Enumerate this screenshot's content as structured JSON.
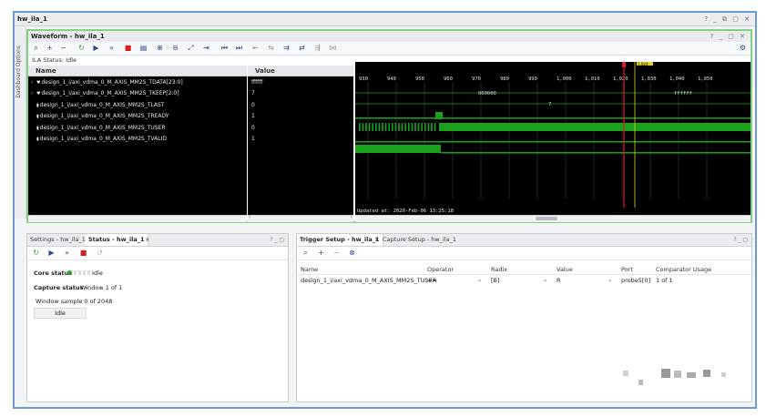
{
  "window": {
    "title": "hw_ila_1",
    "controls": "? _ ⧉ ▢ ✕"
  },
  "side_tab": {
    "label": "Dashboard Options"
  },
  "waveform": {
    "title": "Waveform - hw_ila_1",
    "controls": "? _ ▢ ✕",
    "ila_status": "ILA Status: Idle",
    "col_name": "Name",
    "col_value": "Value",
    "signals": [
      {
        "name": "design_1_i/axi_vdma_0_M_AXIS_MM2S_TDATA[23:0]",
        "value": "ffffff",
        "expand": "›"
      },
      {
        "name": "design_1_i/axi_vdma_0_M_AXIS_MM2S_TKEEP[2:0]",
        "value": "7",
        "expand": "›"
      },
      {
        "name": "design_1_i/axi_vdma_0_M_AXIS_MM2S_TLAST",
        "value": "0",
        "expand": ""
      },
      {
        "name": "design_1_i/axi_vdma_0_M_AXIS_MM2S_TREADY",
        "value": "1",
        "expand": ""
      },
      {
        "name": "design_1_i/axi_vdma_0_M_AXIS_MM2S_TUSER",
        "value": "0",
        "expand": ""
      },
      {
        "name": "design_1_i/axi_vdma_0_M_AXIS_MM2S_TVALID",
        "value": "1",
        "expand": ""
      }
    ],
    "ticks": [
      "930",
      "940",
      "950",
      "960",
      "970",
      "980",
      "990",
      "1,000",
      "1,010",
      "1,020",
      "1,030",
      "1,040",
      "1,050"
    ],
    "bus_values": {
      "tdata_left": "000000",
      "tdata_right": "ffffff",
      "tkeep": "7"
    },
    "updated": "Updated at: 2020-Feb-06 13:25:18",
    "marker_label": "1,024"
  },
  "settings_panel": {
    "tabs": [
      "Settings - hw_ila_1",
      "Status - hw_ila_1"
    ],
    "close": "×",
    "controls": "? _ ▢",
    "core_status_label": "Core status",
    "core_status_value": "Idle",
    "capture_status_label": "Capture status -",
    "capture_status_value": "Window 1 of 1",
    "window_sample": "Window sample 0 of 2048",
    "idle_box": "Idle"
  },
  "trigger_panel": {
    "tabs": [
      "Trigger Setup - hw_ila_1",
      "Capture Setup - hw_ila_1"
    ],
    "close": "×",
    "controls": "? _ ▢",
    "columns": [
      "Name",
      "Operator",
      "Radix",
      "Value",
      "Port",
      "Comparator Usage"
    ],
    "row": {
      "name": "design_1_i/axi_vdma_0_M_AXIS_MM2S_TUSER",
      "operator": "==",
      "radix": "[B]",
      "value": "R",
      "port": "probe5[0]",
      "usage": "1 of 1"
    }
  },
  "colors": {
    "accent": "#6d9ad6",
    "wave_border": "#7fd27f",
    "signal_green": "#1aa31a",
    "marker_red": "#e02020",
    "marker_yellow": "#e0d020"
  }
}
